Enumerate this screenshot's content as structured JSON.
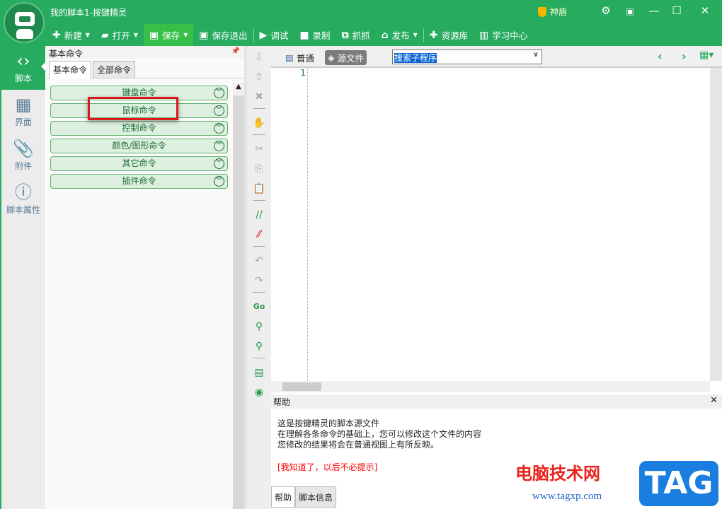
{
  "window": {
    "title": "我的脚本1-按键精灵",
    "shield": "神盾",
    "controls": [
      "⚙",
      "▣",
      "—",
      "☐",
      "✕"
    ]
  },
  "toolbar": [
    {
      "icon": "plus-icon",
      "g": "✚",
      "label": "新建",
      "caret": true
    },
    {
      "icon": "folder-icon",
      "g": "▰",
      "label": "打开",
      "caret": true
    },
    {
      "icon": "save-icon",
      "g": "▣",
      "label": "保存",
      "caret": true,
      "active": true
    },
    {
      "icon": "save-exit-icon",
      "g": "▣",
      "label": "保存退出"
    },
    {
      "icon": "play-icon",
      "g": "▶",
      "label": "调试"
    },
    {
      "icon": "camera-icon",
      "g": "■",
      "label": "录制"
    },
    {
      "icon": "capture-icon",
      "g": "⧉",
      "label": "抓抓"
    },
    {
      "icon": "publish-icon",
      "g": "⌂",
      "label": "发布",
      "caret": true
    },
    {
      "icon": "resource-icon",
      "g": "✚",
      "label": "资源库"
    },
    {
      "icon": "book-icon",
      "g": "▥",
      "label": "学习中心"
    }
  ],
  "nav": [
    {
      "label": "脚本",
      "g": "‹›",
      "active": true
    },
    {
      "label": "界面",
      "g": "▦"
    },
    {
      "label": "附件",
      "g": "📎"
    },
    {
      "label": "脚本属性",
      "g": "ⓘ"
    }
  ],
  "left_panel": {
    "title": "基本命令",
    "tabs": [
      "基本命令",
      "全部命令"
    ],
    "commands": [
      "键盘命令",
      "鼠标命令",
      "控制命令",
      "颜色/图形命令",
      "其它命令",
      "插件命令"
    ]
  },
  "editor": {
    "modes": [
      "普通",
      "源文件"
    ],
    "search_value": "搜索子程序",
    "line_number": "1"
  },
  "help": {
    "title": "帮助",
    "lines": [
      "这是按键精灵的脚本源文件",
      "在理解各条命令的基础上，您可以修改这个文件的内容",
      "您修改的结果将会在普通视图上有所反映。"
    ],
    "dismiss": "[我知道了，以后不必提示]",
    "tabs": [
      "帮助",
      "脚本信息"
    ]
  },
  "watermark": {
    "site": "电脑技术网",
    "url": "www.tagxp.com",
    "tag": "TAG"
  }
}
